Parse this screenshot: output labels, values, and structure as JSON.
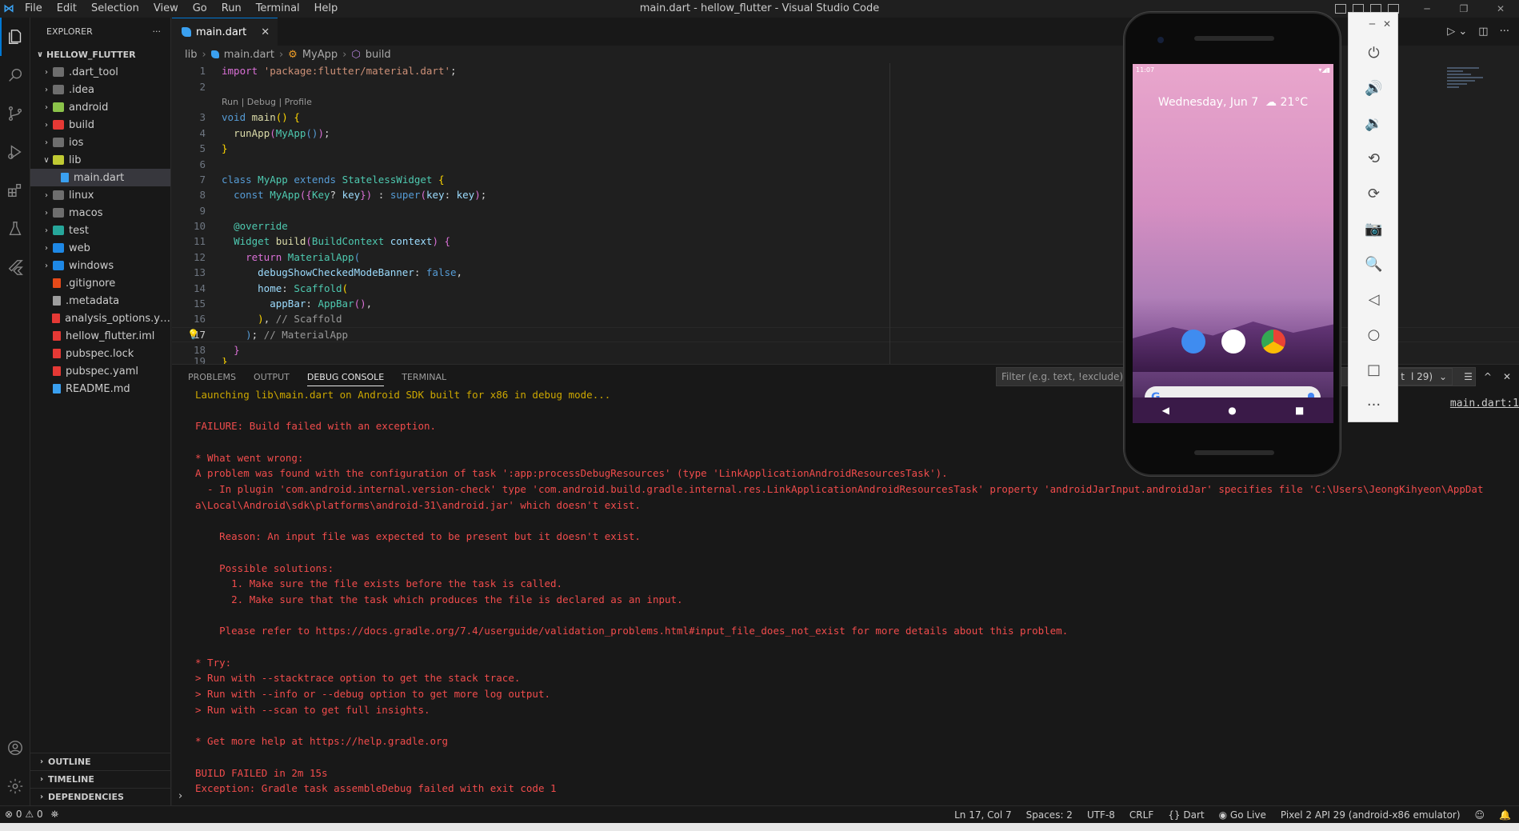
{
  "window": {
    "title": "main.dart - hellow_flutter - Visual Studio Code",
    "menu": [
      "File",
      "Edit",
      "Selection",
      "View",
      "Go",
      "Run",
      "Terminal",
      "Help"
    ]
  },
  "sidebar": {
    "title": "EXPLORER",
    "more": "···",
    "root": "HELLOW_FLUTTER",
    "items": [
      {
        "label": ".dart_tool",
        "type": "folder",
        "color": "#6e6e6e",
        "indent": 1
      },
      {
        "label": ".idea",
        "type": "folder",
        "color": "#6e6e6e",
        "indent": 1
      },
      {
        "label": "android",
        "type": "folder",
        "color": "#8bc34a",
        "indent": 1
      },
      {
        "label": "build",
        "type": "folder",
        "color": "#e53935",
        "indent": 1
      },
      {
        "label": "ios",
        "type": "folder",
        "color": "#6e6e6e",
        "indent": 1
      },
      {
        "label": "lib",
        "type": "folder-open",
        "color": "#c0ca33",
        "indent": 1
      },
      {
        "label": "main.dart",
        "type": "file",
        "color": "#3aa0f0",
        "indent": 2
      },
      {
        "label": "linux",
        "type": "folder",
        "color": "#6e6e6e",
        "indent": 1
      },
      {
        "label": "macos",
        "type": "folder",
        "color": "#6e6e6e",
        "indent": 1
      },
      {
        "label": "test",
        "type": "folder",
        "color": "#26a69a",
        "indent": 1
      },
      {
        "label": "web",
        "type": "folder",
        "color": "#1e88e5",
        "indent": 1
      },
      {
        "label": "windows",
        "type": "folder",
        "color": "#1e88e5",
        "indent": 1
      },
      {
        "label": ".gitignore",
        "type": "file",
        "color": "#e64a19",
        "indent": 1
      },
      {
        "label": ".metadata",
        "type": "file",
        "color": "#9e9e9e",
        "indent": 1
      },
      {
        "label": "analysis_options.ya...",
        "type": "file",
        "color": "#e53935",
        "indent": 1
      },
      {
        "label": "hellow_flutter.iml",
        "type": "file",
        "color": "#e53935",
        "indent": 1
      },
      {
        "label": "pubspec.lock",
        "type": "file",
        "color": "#e53935",
        "indent": 1
      },
      {
        "label": "pubspec.yaml",
        "type": "file",
        "color": "#e53935",
        "indent": 1
      },
      {
        "label": "README.md",
        "type": "file",
        "color": "#3aa0f0",
        "indent": 1
      }
    ],
    "sections": [
      "OUTLINE",
      "TIMELINE",
      "DEPENDENCIES"
    ]
  },
  "editor": {
    "tab": "main.dart",
    "breadcrumb": [
      "lib",
      "main.dart",
      "MyApp",
      "build"
    ],
    "codelens": "Run | Debug | Profile",
    "current_line": "17"
  },
  "panel": {
    "tabs": [
      "PROBLEMS",
      "OUTPUT",
      "DEBUG CONSOLE",
      "TERMINAL"
    ],
    "active_tab": "DEBUG CONSOLE",
    "filter_placeholder": "Filter (e.g. text, !exclude)",
    "session": "t",
    "session_suffix": "l 29)",
    "source_ref": "main.dart:1",
    "console_lines": [
      {
        "t": "Launching lib\\main.dart on Android SDK built for x86 in debug mode...",
        "k": "warn"
      },
      {
        "t": "",
        "k": "err"
      },
      {
        "t": "FAILURE: Build failed with an exception.",
        "k": "err"
      },
      {
        "t": "",
        "k": "err"
      },
      {
        "t": "* What went wrong:",
        "k": "err"
      },
      {
        "t": "A problem was found with the configuration of task ':app:processDebugResources' (type 'LinkApplicationAndroidResourcesTask').",
        "k": "err"
      },
      {
        "t": "  - In plugin 'com.android.internal.version-check' type 'com.android.build.gradle.internal.res.LinkApplicationAndroidResourcesTask' property 'androidJarInput.androidJar' specifies file 'C:\\Users\\JeongKihyeon\\AppDat",
        "k": "err"
      },
      {
        "t": "a\\Local\\Android\\sdk\\platforms\\android-31\\android.jar' which doesn't exist.",
        "k": "err"
      },
      {
        "t": "",
        "k": "err"
      },
      {
        "t": "    Reason: An input file was expected to be present but it doesn't exist.",
        "k": "err"
      },
      {
        "t": "",
        "k": "err"
      },
      {
        "t": "    Possible solutions:",
        "k": "err"
      },
      {
        "t": "      1. Make sure the file exists before the task is called.",
        "k": "err"
      },
      {
        "t": "      2. Make sure that the task which produces the file is declared as an input.",
        "k": "err"
      },
      {
        "t": "",
        "k": "err"
      },
      {
        "t": "    Please refer to https://docs.gradle.org/7.4/userguide/validation_problems.html#input_file_does_not_exist for more details about this problem.",
        "k": "err"
      },
      {
        "t": "",
        "k": "err"
      },
      {
        "t": "* Try:",
        "k": "err"
      },
      {
        "t": "> Run with --stacktrace option to get the stack trace.",
        "k": "err"
      },
      {
        "t": "> Run with --info or --debug option to get more log output.",
        "k": "err"
      },
      {
        "t": "> Run with --scan to get full insights.",
        "k": "err"
      },
      {
        "t": "",
        "k": "err"
      },
      {
        "t": "* Get more help at https://help.gradle.org",
        "k": "err"
      },
      {
        "t": "",
        "k": "err"
      },
      {
        "t": "BUILD FAILED in 2m 15s",
        "k": "err"
      },
      {
        "t": "Exception: Gradle task assembleDebug failed with exit code 1",
        "k": "err"
      }
    ],
    "prompt": "›"
  },
  "statusbar": {
    "errors": "0",
    "warnings": "0",
    "position": "Ln 17, Col 7",
    "spaces": "Spaces: 2",
    "encoding": "UTF-8",
    "eol": "CRLF",
    "language": "Dart",
    "golive": "Go Live",
    "device": "Pixel 2 API 29 (android-x86 emulator)"
  },
  "emulator": {
    "time": "11:07",
    "date": "Wednesday, Jun 7",
    "weather": "21°C",
    "google": "G",
    "dock_colors": [
      "#3f8cf0",
      "#ffffff",
      "#f4f4f4"
    ]
  }
}
